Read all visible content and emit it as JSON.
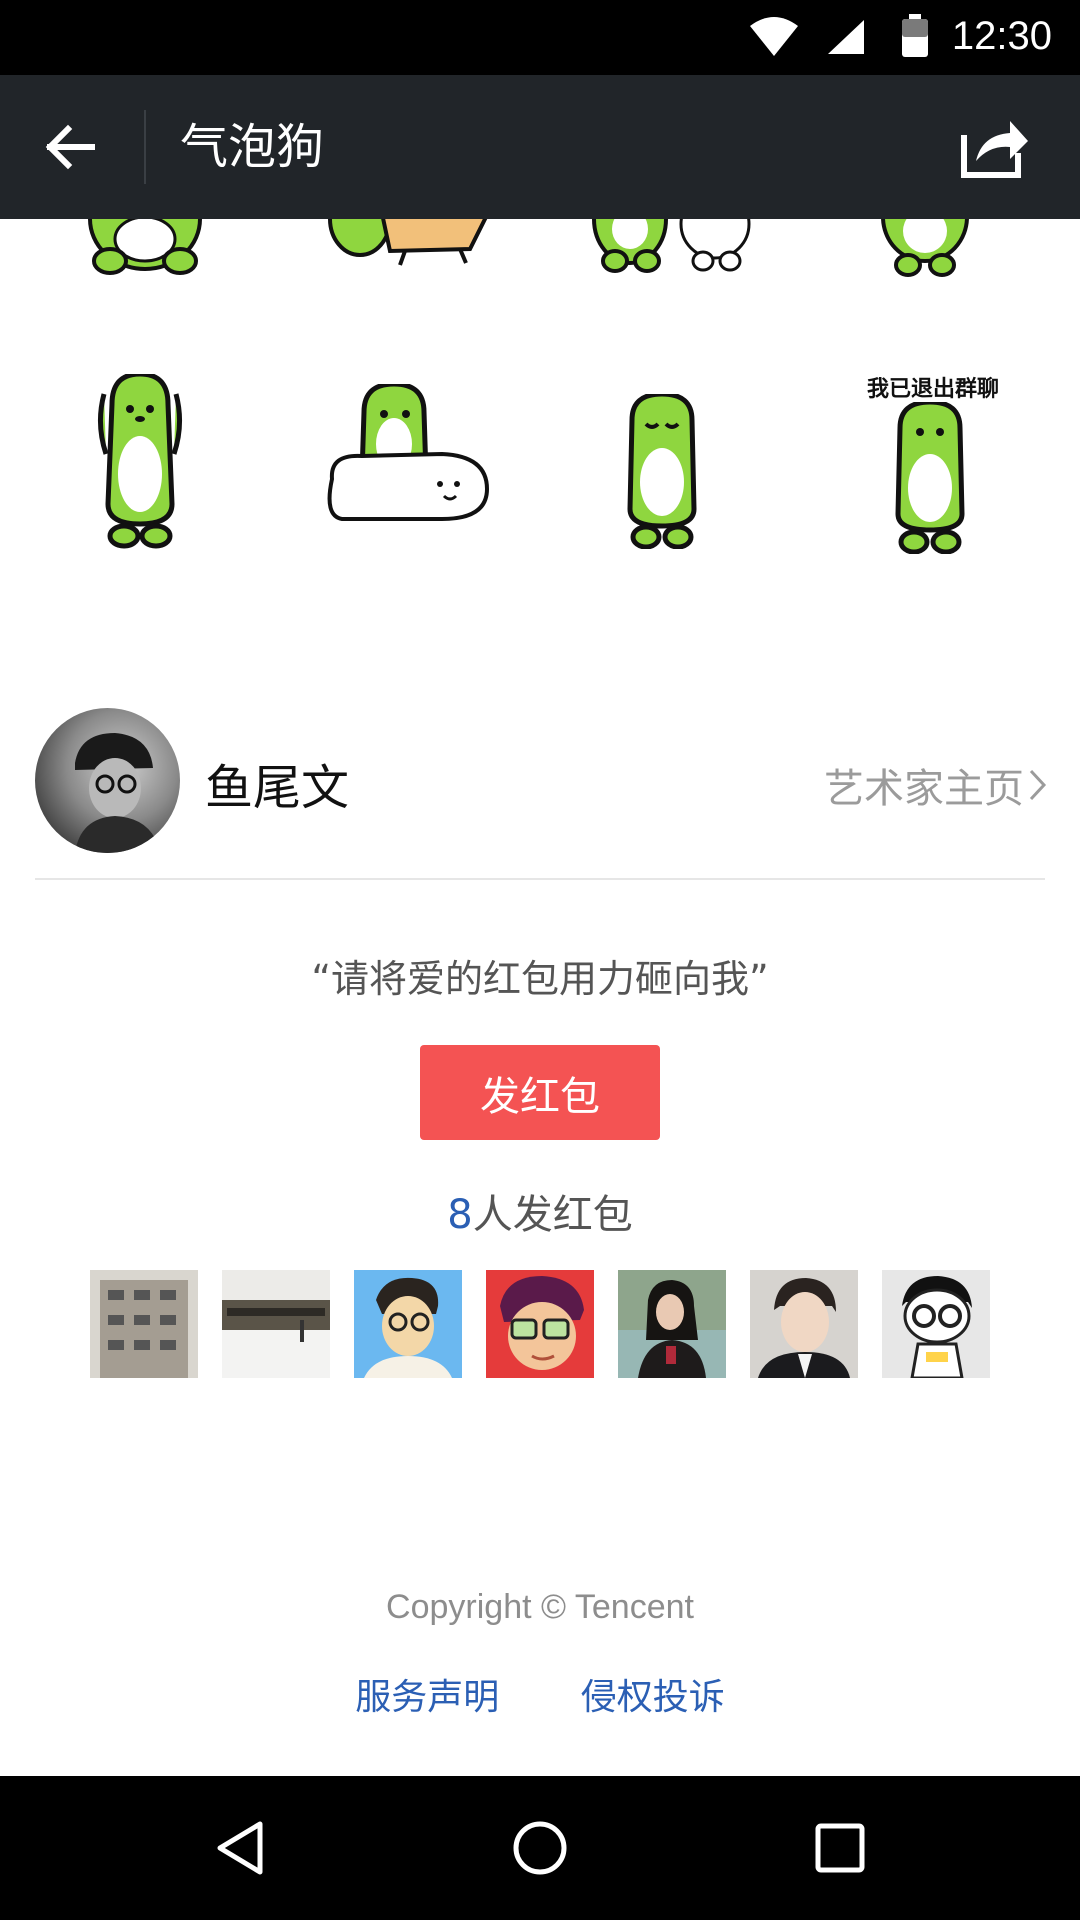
{
  "status_bar": {
    "time": "12:30",
    "icons": [
      "wifi-icon",
      "signal-icon",
      "battery-icon"
    ]
  },
  "app_bar": {
    "title": "气泡狗",
    "back_icon": "arrow-left-icon",
    "share_icon": "share-icon"
  },
  "stickers": {
    "caption": "我已退出群聊"
  },
  "artist": {
    "name": "鱼尾文",
    "link_label": "艺术家主页"
  },
  "quote": "“请将爱的红包用力砸向我”",
  "button": {
    "label": "发红包",
    "color": "#f45353"
  },
  "supporters": {
    "count": "8",
    "suffix": "人发红包"
  },
  "footer": {
    "copyright": "Copyright © Tencent",
    "links": [
      "服务声明",
      "侵权投诉"
    ]
  },
  "colors": {
    "app_bar": "#212529",
    "link_blue": "#2b5fb4",
    "sticker_green": "#8fd63f"
  }
}
